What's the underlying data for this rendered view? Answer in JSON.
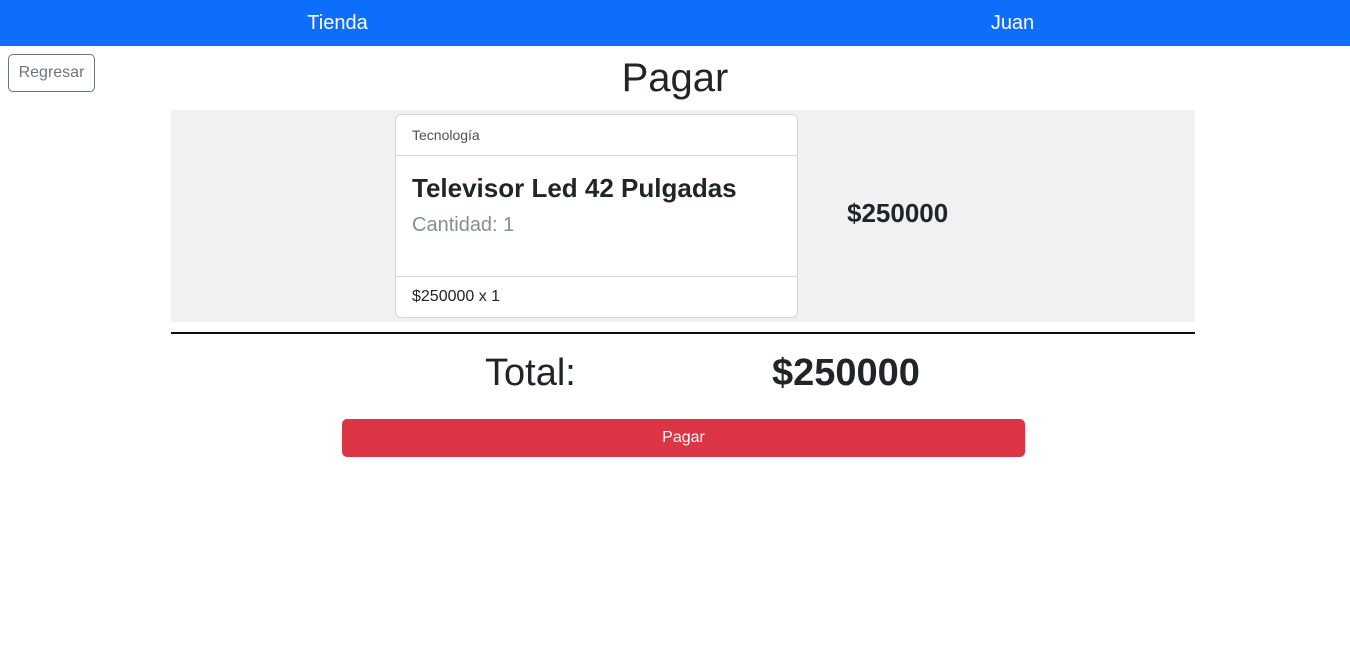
{
  "navbar": {
    "brand": "Tienda",
    "user": "Juan",
    "color": "#0d6efd"
  },
  "back_button": {
    "label": "Regresar"
  },
  "page_title": "Pagar",
  "cart": {
    "items": [
      {
        "category": "Tecnología",
        "name": "Televisor Led 42 Pulgadas",
        "quantity_text": "Cantidad: 1",
        "unit_price_text": "$250000 x 1",
        "line_total": "$250000"
      }
    ]
  },
  "summary": {
    "total_label": "Total:",
    "total_value": "$250000"
  },
  "pay_button": {
    "label": "Pagar",
    "color": "#dc3545"
  }
}
